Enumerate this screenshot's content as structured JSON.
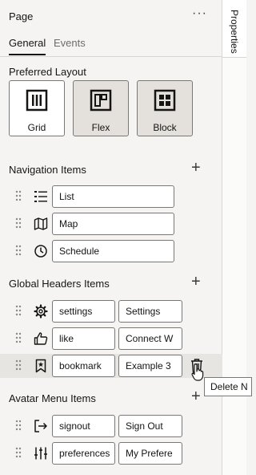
{
  "side_rail": {
    "tab_label": "Properties"
  },
  "header": {
    "title": "Page",
    "more_icon": "ellipsis-icon"
  },
  "tabs": [
    {
      "label": "General",
      "active": true
    },
    {
      "label": "Events",
      "active": false
    }
  ],
  "preferred_layout": {
    "title": "Preferred Layout",
    "options": [
      {
        "label": "Grid",
        "icon": "grid-columns-icon",
        "selected": false
      },
      {
        "label": "Flex",
        "icon": "flex-layout-icon",
        "selected": true
      },
      {
        "label": "Block",
        "icon": "block-grid-icon",
        "selected": true
      }
    ]
  },
  "navigation_items": {
    "title": "Navigation Items",
    "items": [
      {
        "icon": "list-icon",
        "value": "List"
      },
      {
        "icon": "map-icon",
        "value": "Map"
      },
      {
        "icon": "clock-icon",
        "value": "Schedule"
      }
    ]
  },
  "global_headers": {
    "title": "Global Headers Items",
    "items": [
      {
        "icon": "gear-icon",
        "value": "settings",
        "label": "Settings"
      },
      {
        "icon": "thumbs-up-icon",
        "value": "like",
        "label": "Connect W"
      },
      {
        "icon": "bookmark-icon",
        "value": "bookmark",
        "label": "Example 3"
      }
    ]
  },
  "avatar_menu": {
    "title": "Avatar Menu Items",
    "items": [
      {
        "icon": "sign-out-icon",
        "value": "signout",
        "label": "Sign Out"
      },
      {
        "icon": "sliders-icon",
        "value": "preferences",
        "label": "My Prefere"
      }
    ]
  },
  "tooltip": {
    "text": "Delete N"
  },
  "colors": {
    "text": "#161513",
    "border": "#7a7874",
    "selected_bg": "#e4e1dc",
    "panel_bg": "#f5f4f2"
  }
}
